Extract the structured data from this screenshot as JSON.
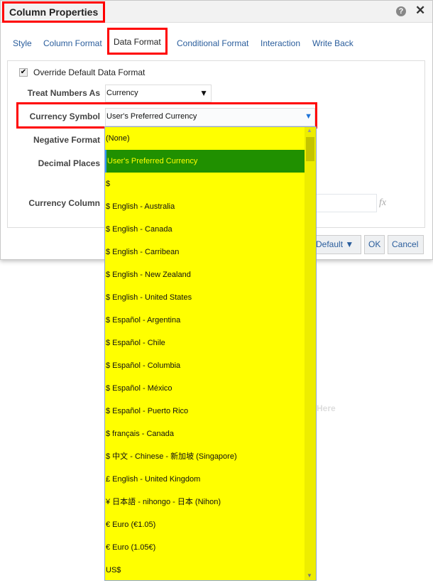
{
  "dialog": {
    "title": "Column Properties",
    "help_icon": "?",
    "close_icon": "✕"
  },
  "tabs": [
    "Style",
    "Column Format",
    "Data Format",
    "Conditional Format",
    "Interaction",
    "Write Back"
  ],
  "form": {
    "override_label": "Override Default Data Format",
    "override_checked": true,
    "treat_label": "Treat Numbers As",
    "treat_value": "Currency",
    "currency_label": "Currency Symbol",
    "currency_value": "User's Preferred Currency",
    "negative_label": "Negative Format",
    "decimal_label": "Decimal Places",
    "column_label": "Currency Column",
    "fx": "fx"
  },
  "buttons": {
    "default": "Default ▼",
    "ok": "OK",
    "cancel": "Cancel"
  },
  "background_text": "Here",
  "dropdown": {
    "selected_index": 1,
    "options": [
      "(None)",
      "User's Preferred Currency",
      "$",
      "$ English - Australia",
      "$ English - Canada",
      "$ English - Carribean",
      "$ English - New Zealand",
      "$ English - United States",
      "$ Español - Argentina",
      "$ Español - Chile",
      "$ Español - Columbia",
      "$ Español - México",
      "$ Español - Puerto Rico",
      "$ français - Canada",
      "$ 中文 - Chinese - 新加坡 (Singapore)",
      "£ English - United Kingdom",
      "¥ 日本語 - nihongo - 日本 (Nihon)",
      "€ Euro (€1.05)",
      "€ Euro (1.05€)",
      "US$"
    ]
  }
}
